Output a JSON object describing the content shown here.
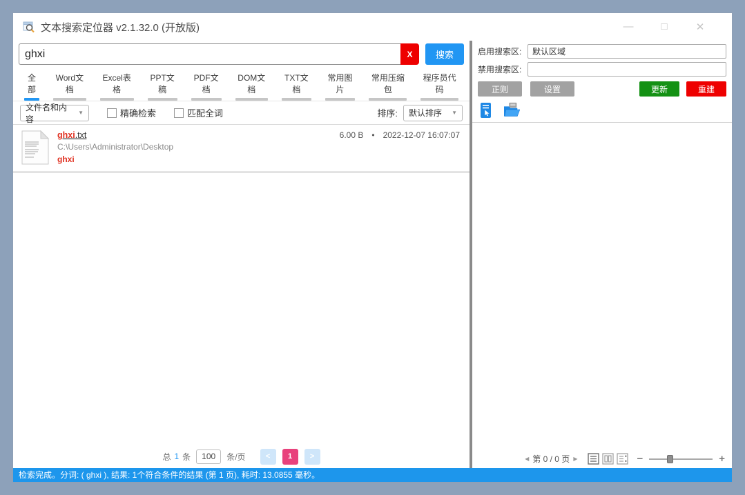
{
  "window": {
    "title": "文本搜索定位器 v2.1.32.0 (开放版)",
    "minimize_glyph": "—",
    "maximize_glyph": "□",
    "close_glyph": "✕"
  },
  "search": {
    "value": "ghxi",
    "clear_label": "X",
    "button_label": "搜索"
  },
  "tabs": [
    {
      "label": "全部",
      "active": true
    },
    {
      "label": "Word文档"
    },
    {
      "label": "Excel表格"
    },
    {
      "label": "PPT文稿"
    },
    {
      "label": "PDF文档"
    },
    {
      "label": "DOM文档"
    },
    {
      "label": "TXT文档"
    },
    {
      "label": "常用图片"
    },
    {
      "label": "常用压缩包"
    },
    {
      "label": "程序员代码"
    }
  ],
  "filters": {
    "scope_dropdown": "文件名和内容",
    "exact_checkbox": "精确检索",
    "whole_word_checkbox": "匹配全词",
    "sort_label": "排序:",
    "sort_value": "默认排序"
  },
  "results": [
    {
      "name_highlight": "ghxi",
      "name_rest": ".txt",
      "size": "6.00 B",
      "bullet": "•",
      "date": "2022-12-07 16:07:07",
      "path": "C:\\Users\\Administrator\\Desktop",
      "match": "ghxi"
    }
  ],
  "pagination": {
    "total_prefix": "总",
    "total_count": "1",
    "total_suffix": "条",
    "page_size": "100",
    "per_page_label": "条/页",
    "prev_label": "<",
    "current_page": "1",
    "next_label": ">"
  },
  "right_panel": {
    "enabled_zone_label": "启用搜索区:",
    "enabled_zone_value": "默认区域",
    "disabled_zone_label": "禁用搜索区:",
    "disabled_zone_value": "",
    "regex_button": "正则",
    "settings_button": "设置",
    "update_button": "更新",
    "rebuild_button": "重建",
    "pager_prev_glyph": "◀",
    "pager_label": "第 0 / 0 页",
    "pager_next_glyph": "▶",
    "zoom_minus": "−",
    "zoom_plus": "+"
  },
  "status_bar": {
    "text": "检索完成。分词: ( ghxi ), 结果: 1个符合条件的结果 (第 1 页), 耗时: 13.0855 毫秒。"
  },
  "colors": {
    "accent_blue": "#2196f3",
    "clear_red": "#ee0000",
    "update_green": "#149114",
    "rebuild_red": "#ee0000",
    "status_bar_blue": "#1d96ec",
    "current_page_pink": "#e8417c",
    "highlight_red": "#e03020"
  }
}
